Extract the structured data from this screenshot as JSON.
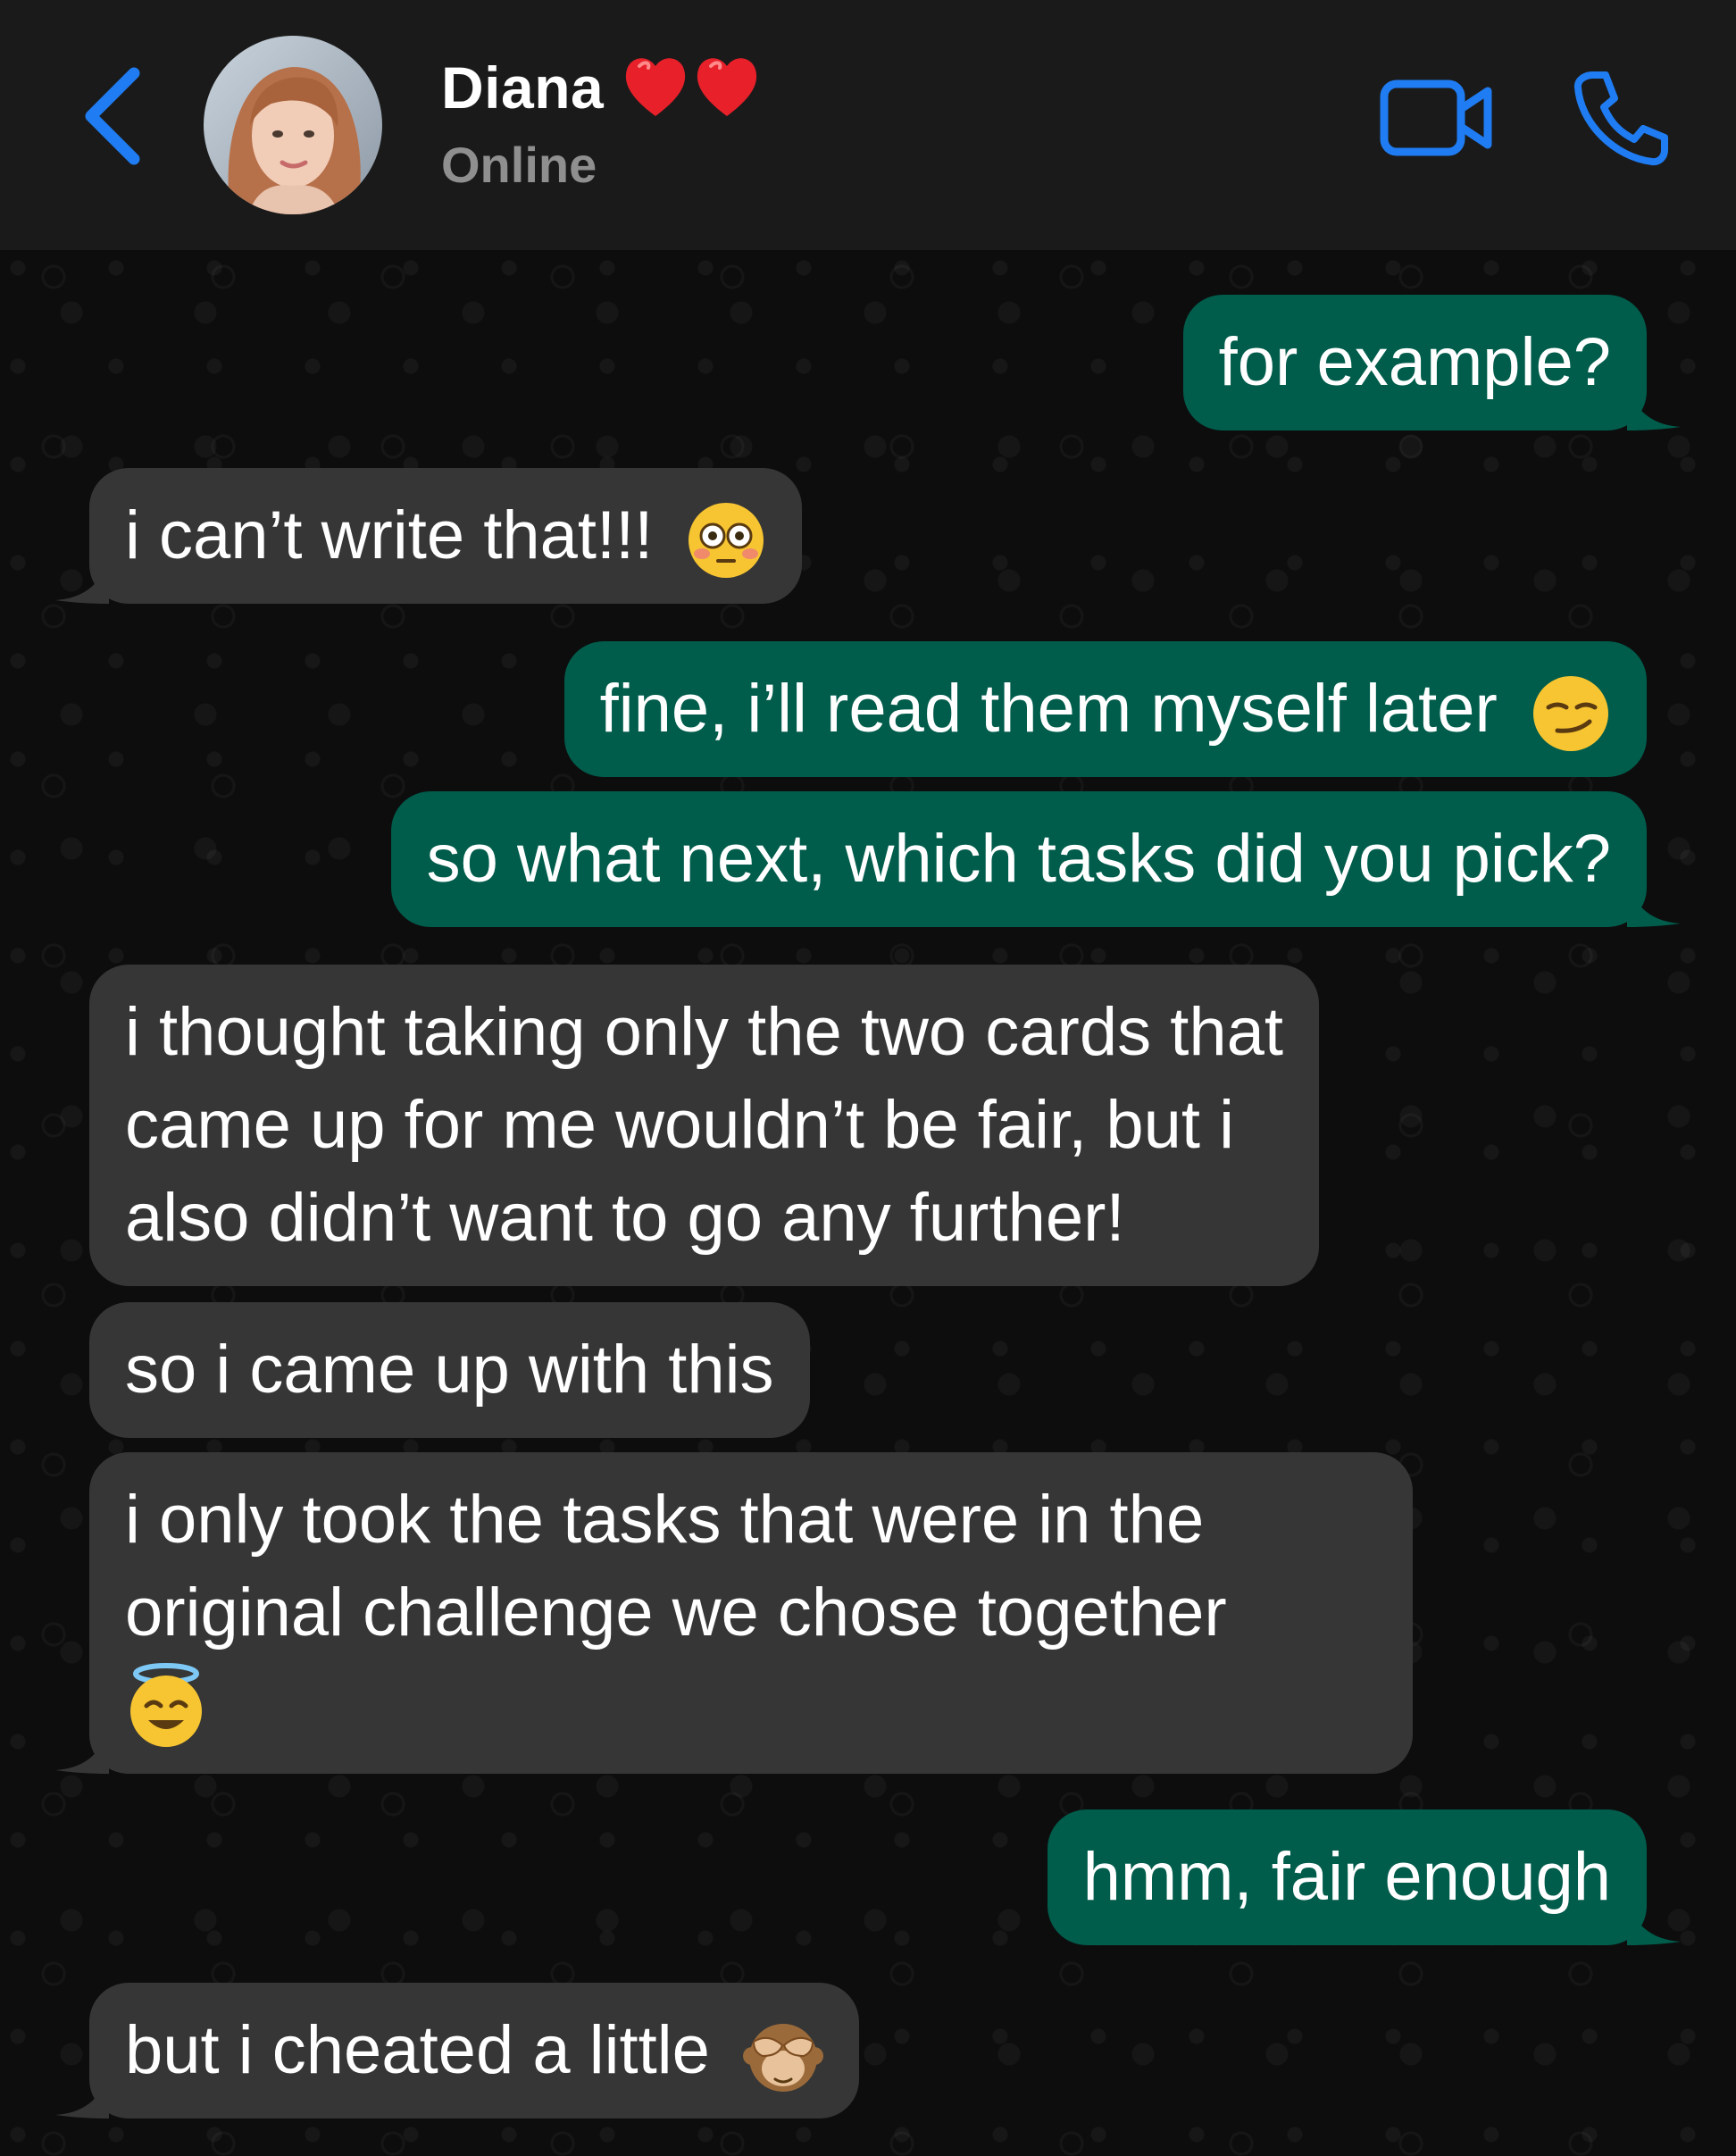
{
  "header": {
    "contact_name": "Diana",
    "contact_status": "Online",
    "name_emojis": [
      "red-heart",
      "red-heart"
    ]
  },
  "colors": {
    "header_bg": "#1a1a1a",
    "accent": "#1f7cf2",
    "incoming_bubble": "#363636",
    "outgoing_bubble": "#005c4b",
    "status_text": "#8f8f8f"
  },
  "messages": [
    {
      "direction": "out",
      "text": "for example?"
    },
    {
      "direction": "in",
      "text": "i can’t write that!!!",
      "emoji": "flushed-face"
    },
    {
      "direction": "out",
      "text": "fine, i’ll read them myself later",
      "emoji": "smirking-face"
    },
    {
      "direction": "out",
      "text": "so what next, which tasks did you pick?"
    },
    {
      "direction": "in",
      "lines": [
        "i thought taking only the two cards that",
        "came up for me wouldn’t be fair, but i",
        "also didn’t want to go any further!"
      ]
    },
    {
      "direction": "in",
      "text": "so i came up with this"
    },
    {
      "direction": "in",
      "lines": [
        "i only took the tasks that were in the",
        "original challenge we chose together"
      ],
      "emoji": "smiling-face-with-halo"
    },
    {
      "direction": "out",
      "text": "hmm, fair enough"
    },
    {
      "direction": "in",
      "text": "but i cheated a little",
      "emoji": "see-no-evil-monkey"
    }
  ]
}
